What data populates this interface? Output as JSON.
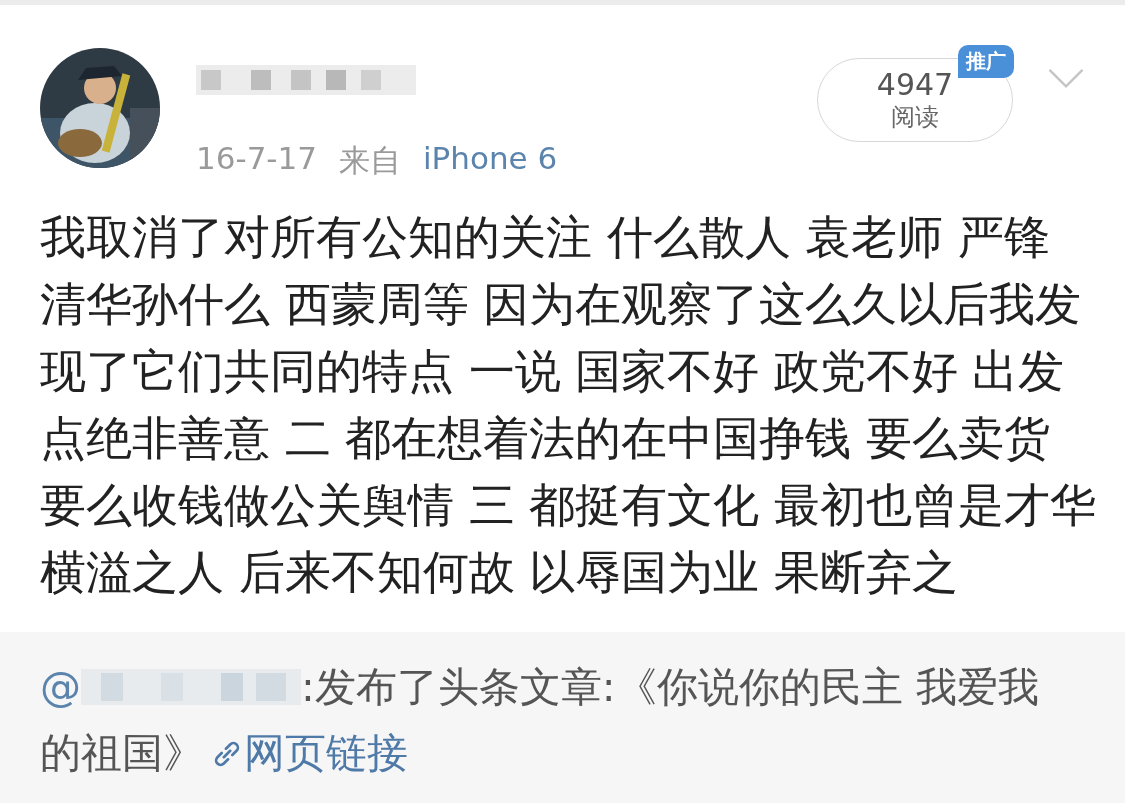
{
  "post": {
    "date": "16-7-17",
    "source_prefix": "来自",
    "source": "iPhone 6",
    "read_count": "4947",
    "read_label": "阅读",
    "promo_badge": "推广",
    "text_lines": [
      "我取消了对所有公知的关注 什么散人 袁老师 严锋",
      "清华孙什么 西蒙周等 因为在观察了这么久以后我发",
      "现了它们共同的特点 一说 国家不好 政党不好 出发",
      "点绝非善意 二 都在想着法的在中国挣钱 要么卖货",
      "要么收钱做公关舆情 三 都挺有文化 最初也曾是才华",
      "横溢之人 后来不知何故 以辱国为业 果断弃之"
    ]
  },
  "repost": {
    "mention": "@",
    "text_lines": [
      ":发布了头条文章:《你说你的民主 我爱我",
      "的祖国》"
    ],
    "link": "网页链接"
  }
}
